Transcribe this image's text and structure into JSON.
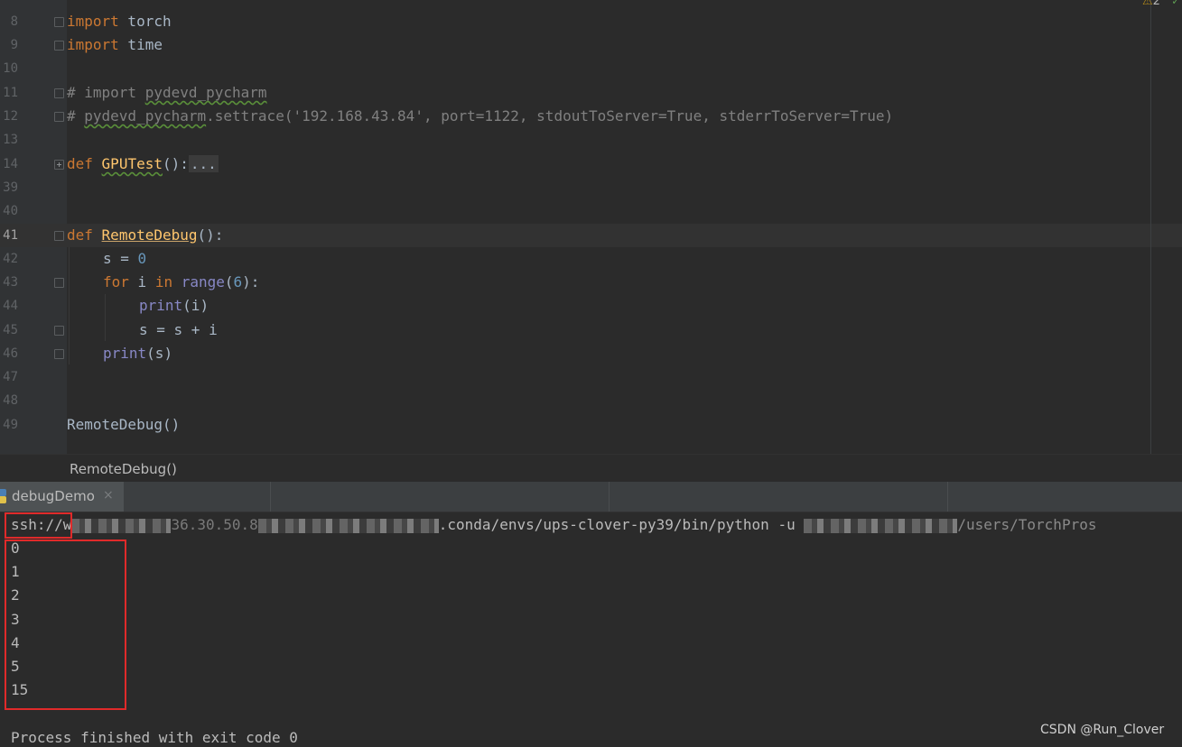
{
  "editor": {
    "warning_count": "2",
    "lines": [
      {
        "num": "8"
      },
      {
        "num": "9"
      },
      {
        "num": "10"
      },
      {
        "num": "11"
      },
      {
        "num": "12"
      },
      {
        "num": "13"
      },
      {
        "num": "14"
      },
      {
        "num": "39"
      },
      {
        "num": "40"
      },
      {
        "num": "41"
      },
      {
        "num": "42"
      },
      {
        "num": "43"
      },
      {
        "num": "44"
      },
      {
        "num": "45"
      },
      {
        "num": "46"
      },
      {
        "num": "47"
      },
      {
        "num": "48"
      },
      {
        "num": "49"
      }
    ],
    "code": {
      "l8_kw": "import",
      "l8_mod": " torch",
      "l9_kw": "import",
      "l9_mod": " time",
      "l11_a": "# import ",
      "l11_b": "pydevd_pycharm",
      "l12_a": "# ",
      "l12_b": "pydevd_pycharm",
      "l12_c": ".settrace('192.168.43.84', port=1122, stdoutToServer=True, stderrToServer=True)",
      "l14_kw": "def",
      "l14_fn": "GPUTest",
      "l14_rest": "():",
      "l14_collapsed": "...",
      "l41_kw": "def",
      "l41_fn": "RemoteDebug",
      "l41_rest": "():",
      "l42_a": "s = ",
      "l42_num": "0",
      "l43_for": "for",
      "l43_i": " i ",
      "l43_in": "in",
      "l43_range": " range",
      "l43_open": "(",
      "l43_num": "6",
      "l43_close": "):",
      "l44_print": "print",
      "l44_rest": "(i)",
      "l45": "s = s + i",
      "l46_print": "print",
      "l46_rest": "(s)",
      "l49": "RemoteDebug()"
    }
  },
  "breadcrumb": "RemoteDebug()",
  "run": {
    "tab_label": "debugDemo",
    "tab_close": "×",
    "command_prefix": "ssh://w",
    "command_visible_mid": "36.30.50.8",
    "command_mid": ".conda/envs/ups-clover-py39/bin/python -u ",
    "command_tail": "/users/TorchPros",
    "output": [
      "0",
      "1",
      "2",
      "3",
      "4",
      "5",
      "15"
    ],
    "exit_message": "Process finished with exit code 0"
  },
  "watermark": "CSDN @Run_Clover",
  "colors": {
    "keyword": "#cc7832",
    "function": "#ffc66d",
    "comment": "#808080",
    "number": "#6897bb",
    "builtin": "#8888c6",
    "highlight_box": "#e02a2a"
  }
}
